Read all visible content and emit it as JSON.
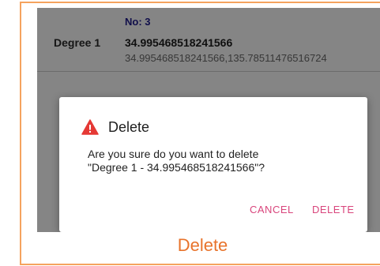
{
  "list_item": {
    "title": "Degree 1",
    "number": "No: 3",
    "value": "34.995468518241566",
    "coordinates": "34.995468518241566,135.78511476516724"
  },
  "dialog": {
    "icon": "warning-icon",
    "title": "Delete",
    "message": "Are you sure do you want to delete\n\"Degree 1 - 34.995468518241566\"?",
    "cancel_label": "CANCEL",
    "delete_label": "DELETE"
  },
  "caption": "Delete",
  "colors": {
    "accent": "#d9457c",
    "caption": "#e8732b",
    "frame_border": "#f5a35e",
    "warning": "#e53935"
  }
}
